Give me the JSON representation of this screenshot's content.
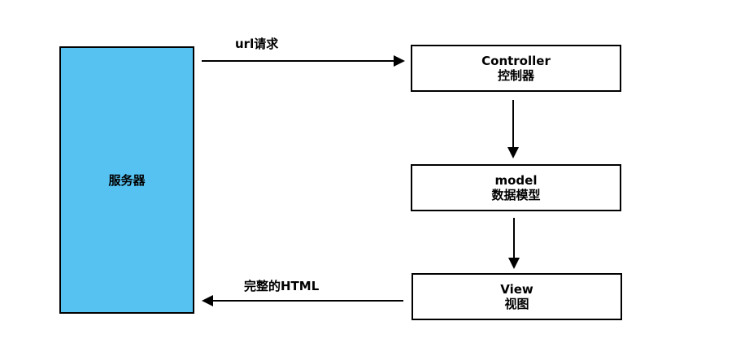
{
  "colors": {
    "server_fill": "#55c2f2",
    "stroke": "#000000",
    "box_fill": "#ffffff"
  },
  "nodes": {
    "server": {
      "label": "服务器"
    },
    "controller": {
      "title": "Controller",
      "subtitle": "控制器"
    },
    "model": {
      "title": "model",
      "subtitle": "数据模型"
    },
    "view": {
      "title": "View",
      "subtitle": "视图"
    }
  },
  "edges": {
    "request": {
      "label": "url请求"
    },
    "response": {
      "label": "完整的HTML"
    }
  }
}
